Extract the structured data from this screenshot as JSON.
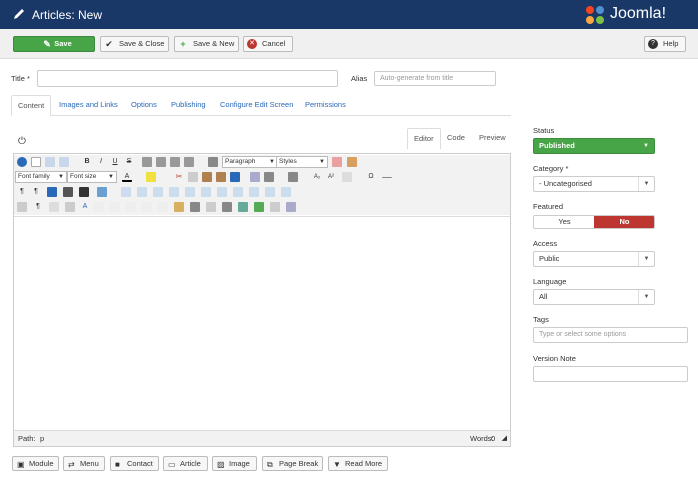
{
  "header": {
    "title": "Articles: New",
    "logo_text": "Joomla!"
  },
  "toolbar": {
    "save": "Save",
    "save_close": "Save & Close",
    "save_new": "Save & New",
    "cancel": "Cancel",
    "help": "Help"
  },
  "form": {
    "title_label": "Title *",
    "title_value": "",
    "alias_label": "Alias",
    "alias_placeholder": "Auto-generate from title"
  },
  "tabs": [
    "Content",
    "Images and Links",
    "Options",
    "Publishing",
    "Configure Edit Screen",
    "Permissions"
  ],
  "editor": {
    "tabs": [
      "Editor",
      "Code",
      "Preview"
    ],
    "paragraph": "Paragraph",
    "styles": "Styles",
    "font_family": "Font family",
    "font_size": "Font size",
    "path_label": "Path:",
    "path_value": "p",
    "words_label": "Words:",
    "words_value": "0"
  },
  "bottom_buttons": [
    "Module",
    "Menu",
    "Contact",
    "Article",
    "Image",
    "Page Break",
    "Read More"
  ],
  "sidebar": {
    "status_label": "Status",
    "status_value": "Published",
    "category_label": "Category *",
    "category_value": "- Uncategorised",
    "featured_label": "Featured",
    "featured_yes": "Yes",
    "featured_no": "No",
    "access_label": "Access",
    "access_value": "Public",
    "language_label": "Language",
    "language_value": "All",
    "tags_label": "Tags",
    "tags_placeholder": "Type or select some options",
    "version_note_label": "Version Note",
    "version_note_value": ""
  },
  "colors": {
    "header_bg": "#1a3867",
    "save_green": "#47a447",
    "published_green": "#47a447",
    "no_red": "#bd362f",
    "link_blue": "#2a69b8"
  }
}
